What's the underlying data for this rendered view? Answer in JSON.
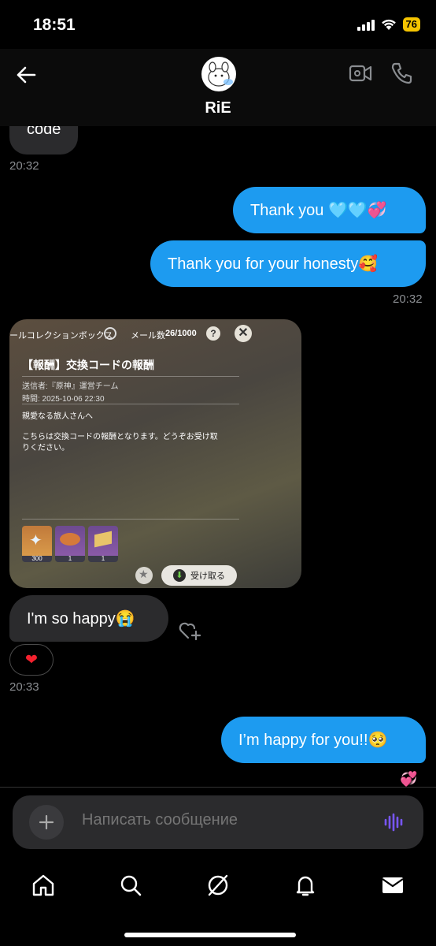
{
  "status": {
    "time": "18:51",
    "battery": "76"
  },
  "header": {
    "name": "RiE"
  },
  "messages": {
    "partial_text": "code",
    "ts1": "20:32",
    "sent1": "Thank you 🩵🩵💞",
    "sent2": "Thank you for your honesty🥰",
    "ts2": "20:32",
    "recv_happy": "I'm so happy😭",
    "reaction": "❤",
    "ts3": "20:33",
    "sent3": "I’m happy for you!!🥺",
    "trailing_emoji": "💞"
  },
  "media": {
    "top_title": "ールコレクションボックス",
    "mail_label": "メール数",
    "mail_count": "26/1000",
    "help": "?",
    "heading": "【報酬】交換コードの報酬",
    "sender": "送信者:『原神』運営チーム",
    "date": "時間: 2025-10-06 22:30",
    "greeting": "親愛なる旅人さんへ",
    "body1": "こちらは交換コードの報酬となります。どうぞお受け取",
    "body2": "りください。",
    "item_counts": [
      "300",
      "1",
      "1"
    ],
    "claim": "受け取る"
  },
  "composer": {
    "placeholder": "Написать сообщение"
  },
  "colors": {
    "sent_bubble": "#1d9bf0",
    "recv_bubble": "#2b2b2d",
    "accent_voice": "#7856ff"
  }
}
